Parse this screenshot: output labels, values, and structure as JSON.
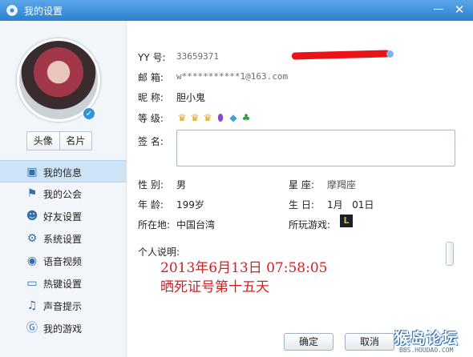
{
  "window": {
    "title": "我的设置",
    "minimize": "—",
    "close": "✕"
  },
  "profile": {
    "avatar_tabs": [
      "头像",
      "名片"
    ]
  },
  "nav": {
    "items": [
      {
        "label": "我的信息",
        "icon": "profile-card-icon",
        "active": true
      },
      {
        "label": "我的公会",
        "icon": "flag-icon",
        "active": false
      },
      {
        "label": "好友设置",
        "icon": "friends-icon",
        "active": false
      },
      {
        "label": "系统设置",
        "icon": "gear-icon",
        "active": false
      },
      {
        "label": "语音视频",
        "icon": "camera-icon",
        "active": false
      },
      {
        "label": "热键设置",
        "icon": "keyboard-icon",
        "active": false
      },
      {
        "label": "声音提示",
        "icon": "music-note-icon",
        "active": false
      },
      {
        "label": "我的游戏",
        "icon": "game-g-icon",
        "active": false
      }
    ]
  },
  "info": {
    "yy_label": "YY 号:",
    "yy_value": "33659371",
    "email_label": "邮  箱:",
    "email_value": "w***********1@163.com",
    "nick_label": "昵  称:",
    "nick_value": "胆小鬼",
    "level_label": "等  级:",
    "sig_label": "签  名:",
    "gender_label": "性  别:",
    "gender_value": "男",
    "star_label": "星  座:",
    "star_value": "摩羯座",
    "age_label": "年  龄:",
    "age_value": "199岁",
    "birthday_label": "生  日:",
    "birthday_value": "1月   01日",
    "location_label": "所在地:",
    "location_value": "中国台湾",
    "games_label": "所玩游戏:",
    "desc_label": "个人说明:",
    "desc_lines": [
      "2013年6月13日  07:58:05",
      "晒死证号第十五天"
    ]
  },
  "buttons": {
    "ok": "确定",
    "cancel": "取消"
  },
  "watermark": {
    "main": "猴岛论坛",
    "sub": "BBS.HOUDAO.COM"
  },
  "colors": {
    "titlebar": "#3a8ad8",
    "accent_red": "#d02222",
    "nav_active": "#cfe3f7"
  }
}
